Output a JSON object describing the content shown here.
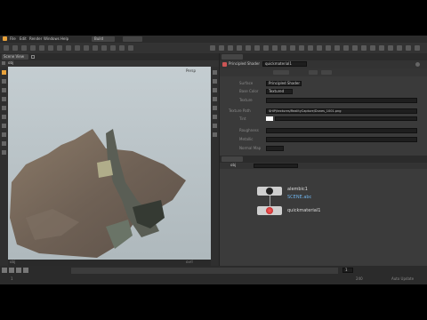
{
  "menu": [
    "File",
    "Edit",
    "Render",
    "Windows",
    "Help"
  ],
  "desktop": "Build",
  "viewport": {
    "tab": "Scene View",
    "path": "obj",
    "camera": "Persp",
    "status_left": "obj",
    "status_right": "ovrl"
  },
  "param_pane": {
    "node_type": "Principled Shader",
    "node_name": "quickmaterial1",
    "fields": [
      {
        "label": "Surface",
        "value": "Principled Shader"
      },
      {
        "label": "Base Color",
        "value": "Textured"
      },
      {
        "label": "Texture",
        "value": ""
      },
      {
        "label": "Texture Path",
        "value": "$HIP/textures/RealityCapture/Dunes_1001.png"
      },
      {
        "label": "Tint",
        "value": ""
      },
      {
        "label": "Roughness",
        "value": ""
      },
      {
        "label": "Metallic",
        "value": ""
      },
      {
        "label": "Normal Map",
        "value": ""
      }
    ]
  },
  "network": {
    "path": "obj",
    "label_top": "alembic1",
    "label_file": "SCENE.abc",
    "label_bottom": "quickmaterial1"
  },
  "timeline": {
    "frame": "1",
    "start": "1",
    "end": "240",
    "playbar_info": "Auto Update"
  },
  "colors": {
    "background": "#3a3a3a",
    "panel_dark": "#2b2b2b",
    "viewport_bg": "#b9c2c6",
    "accent_orange": "#e7a13a",
    "file_blue": "#6fb2e8"
  }
}
